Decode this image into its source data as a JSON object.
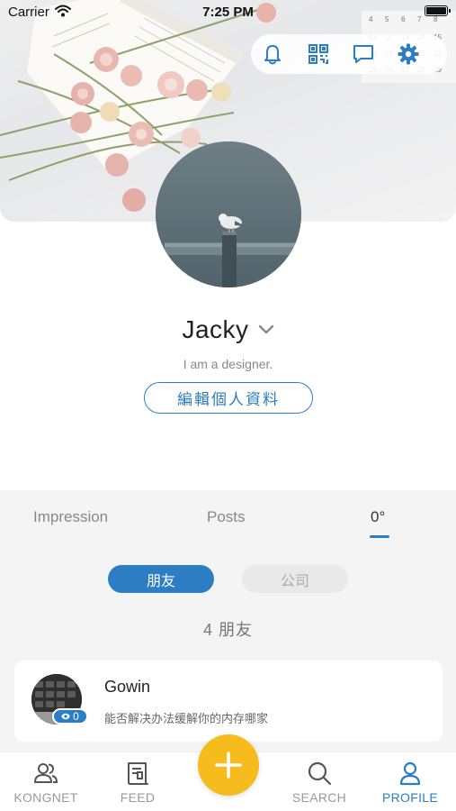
{
  "status_bar": {
    "carrier": "Carrier",
    "time": "7:25 PM"
  },
  "toolbar": {
    "icons": [
      "bell-icon",
      "qr-scan-icon",
      "message-icon",
      "gear-icon"
    ]
  },
  "profile": {
    "name": "Jacky",
    "bio": "I am a designer.",
    "edit_label": "編輯個人資料"
  },
  "tabs": [
    {
      "label": "Impression"
    },
    {
      "label": "Posts"
    },
    {
      "label": "0°"
    }
  ],
  "segments": {
    "friends": "朋友",
    "company": "公司"
  },
  "friend_count": "4 朋友",
  "friends": [
    {
      "name": "Gowin",
      "status": "能否解决办法缓解你的内存哪家",
      "badge_count": "0"
    }
  ],
  "bottom_nav": [
    {
      "label": "KONGNET"
    },
    {
      "label": "FEED"
    },
    {
      "label": "SEARCH"
    },
    {
      "label": "PROFILE"
    }
  ],
  "colors": {
    "accent": "#2d7dc4",
    "fab": "#f6bb1c"
  }
}
